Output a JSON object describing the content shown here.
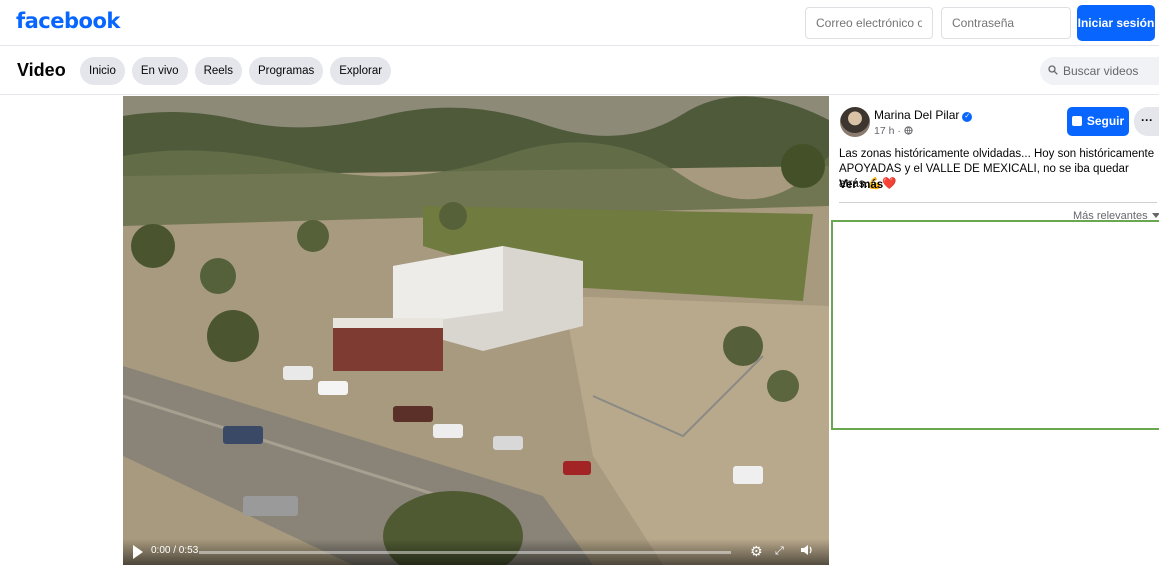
{
  "header": {
    "logo": "facebook",
    "email_placeholder": "Correo electrónico o tel",
    "password_placeholder": "Contraseña",
    "login_label": "Iniciar sesión"
  },
  "nav": {
    "title": "Video",
    "tabs": [
      {
        "label": "Inicio"
      },
      {
        "label": "En vivo"
      },
      {
        "label": "Reels"
      },
      {
        "label": "Programas"
      },
      {
        "label": "Explorar"
      }
    ],
    "search_placeholder": "Buscar videos"
  },
  "video": {
    "time": "0:00 / 0:53",
    "progress_fraction": 0.0,
    "controls": [
      "play-icon",
      "settings-icon",
      "fullscreen-icon",
      "volume-icon"
    ]
  },
  "post": {
    "author": "Marina Del Pilar",
    "meta": "17 h · ",
    "follow_label": "Seguir",
    "more_label": "···",
    "text": "Las zonas históricamente olvidadas... Hoy son históricamente APOYADAS y el VALLE DE MEXICALI, no se iba quedar atrás.💪❤️",
    "see_more": "Ver más",
    "sort_label": "Más relevantes",
    "accent_color": "#0866ff"
  },
  "highlight_color": "#6aa84f"
}
